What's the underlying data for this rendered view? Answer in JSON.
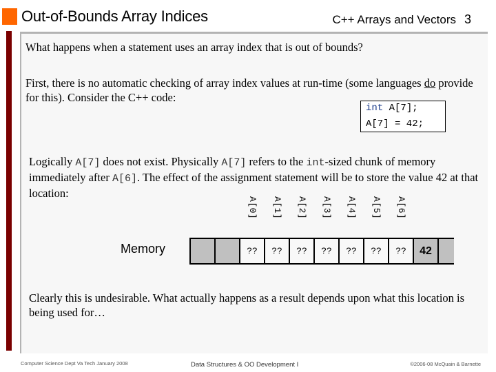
{
  "header": {
    "title": "Out-of-Bounds Array Indices",
    "section": "C++ Arrays and Vectors",
    "page_number": "3"
  },
  "colors": {
    "accent_square": "#ff6600",
    "left_bar": "#7a0000",
    "panel_background": "#f7f7f7",
    "memory_filled": "#c0c0c0"
  },
  "body": {
    "question": "What happens when a statement uses an array index that is out of bounds?",
    "para2_before": "First, there is no automatic checking of array index values at run-time (some languages ",
    "para2_underlined": "do",
    "para2_after": " provide for this).  Consider the C++ code:",
    "code": {
      "line1_keyword": "int",
      "line1_rest": " A[7];",
      "line2": "A[7] = 42;"
    },
    "para3": {
      "t1": "Logically ",
      "c1": "A[7]",
      "t2": " does not exist. Physically ",
      "c2": "A[7]",
      "t3": " refers to the ",
      "c3": "int",
      "t4": "-sized chunk of memory immediately after ",
      "c4": "A[6]",
      "t5": ".  The effect of the assignment statement will be to store the value 42 at that location:"
    },
    "conclusion": "Clearly this is undesirable.  What actually happens as a result depends upon what this location is being used for…"
  },
  "diagram": {
    "memory_label": "Memory",
    "index_labels": [
      "A[0]",
      "A[1]",
      "A[2]",
      "A[3]",
      "A[4]",
      "A[5]",
      "A[6]"
    ],
    "cells": [
      {
        "text": "",
        "kind": "grey"
      },
      {
        "text": "",
        "kind": "grey"
      },
      {
        "text": "??",
        "kind": "white"
      },
      {
        "text": "??",
        "kind": "white"
      },
      {
        "text": "??",
        "kind": "white"
      },
      {
        "text": "??",
        "kind": "white"
      },
      {
        "text": "??",
        "kind": "white"
      },
      {
        "text": "??",
        "kind": "white"
      },
      {
        "text": "??",
        "kind": "white"
      },
      {
        "text": "42",
        "kind": "value"
      }
    ]
  },
  "footer": {
    "left": "Computer Science Dept Va Tech January 2008",
    "center": "Data Structures & OO Development I",
    "right": "©2006-08  McQuain & Barnette"
  }
}
